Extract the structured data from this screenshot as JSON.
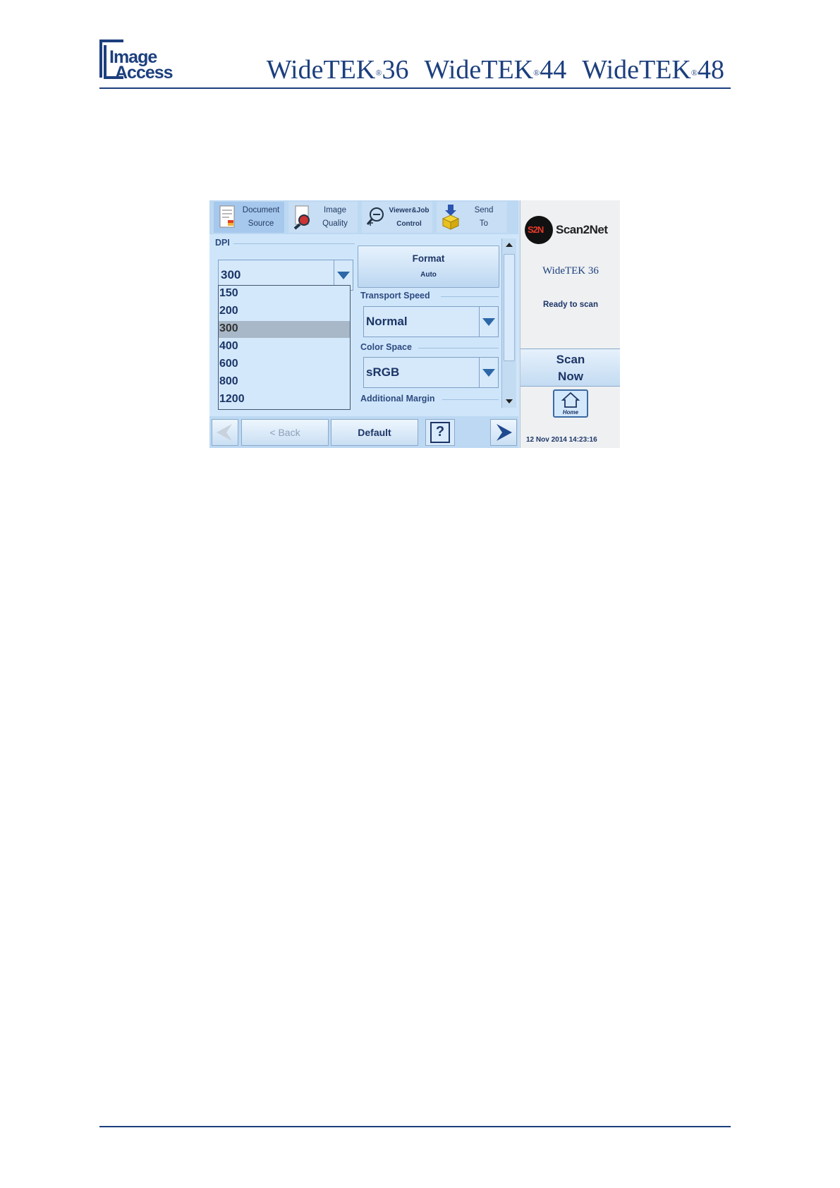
{
  "header": {
    "logo_line1": "Image",
    "logo_line2": "Access",
    "models": [
      {
        "name": "WideTEK",
        "reg": "®",
        "num": "36"
      },
      {
        "name": "WideTEK",
        "reg": "®",
        "num": "44"
      },
      {
        "name": "WideTEK",
        "reg": "®",
        "num": "48"
      }
    ]
  },
  "screen": {
    "tabs": [
      {
        "line1": "Document",
        "line2": "Source"
      },
      {
        "line1": "Image",
        "line2": "Quality"
      },
      {
        "line1": "Viewer&Job",
        "line2": "Control"
      },
      {
        "line1": "Send",
        "line2": "To"
      }
    ],
    "dpi": {
      "label": "DPI",
      "value": "300",
      "options": [
        "150",
        "200",
        "300",
        "400",
        "600",
        "800",
        "1200"
      ],
      "selected_index": 2
    },
    "format": {
      "label": "Format",
      "value": "Auto"
    },
    "transport_speed": {
      "label": "Transport Speed",
      "value": "Normal"
    },
    "color_space": {
      "label": "Color Space",
      "value": "sRGB"
    },
    "additional_margin": {
      "label": "Additional Margin"
    },
    "bottom": {
      "back_label": "< Back",
      "default_label": "Default",
      "help_label": "?"
    },
    "sidebar": {
      "logo_text": "Scan2Net",
      "logo_badge": "S2N",
      "model": "WideTEK 36",
      "status": "Ready to scan",
      "scan_line1": "Scan",
      "scan_line2": "Now",
      "home_label": "Home",
      "datetime": "12 Nov 2014 14:23:16"
    }
  },
  "colors": {
    "brand": "#1c3f7e",
    "panel": "#cfe6fa",
    "arrow": "#2c67a7"
  }
}
